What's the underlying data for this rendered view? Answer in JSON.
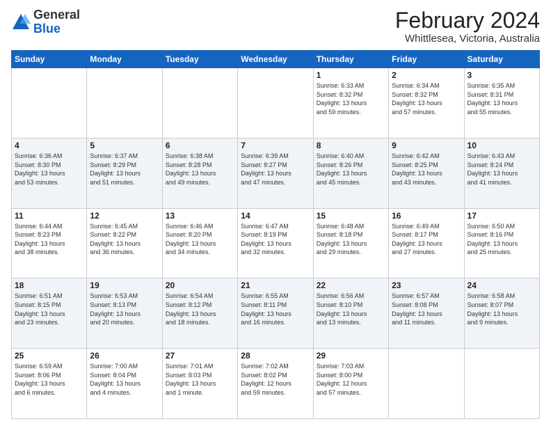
{
  "header": {
    "logo": {
      "line1": "General",
      "line2": "Blue"
    },
    "title": "February 2024",
    "location": "Whittlesea, Victoria, Australia"
  },
  "weekdays": [
    "Sunday",
    "Monday",
    "Tuesday",
    "Wednesday",
    "Thursday",
    "Friday",
    "Saturday"
  ],
  "weeks": [
    [
      {
        "day": "",
        "info": ""
      },
      {
        "day": "",
        "info": ""
      },
      {
        "day": "",
        "info": ""
      },
      {
        "day": "",
        "info": ""
      },
      {
        "day": "1",
        "info": "Sunrise: 6:33 AM\nSunset: 8:32 PM\nDaylight: 13 hours\nand 59 minutes."
      },
      {
        "day": "2",
        "info": "Sunrise: 6:34 AM\nSunset: 8:32 PM\nDaylight: 13 hours\nand 57 minutes."
      },
      {
        "day": "3",
        "info": "Sunrise: 6:35 AM\nSunset: 8:31 PM\nDaylight: 13 hours\nand 55 minutes."
      }
    ],
    [
      {
        "day": "4",
        "info": "Sunrise: 6:36 AM\nSunset: 8:30 PM\nDaylight: 13 hours\nand 53 minutes."
      },
      {
        "day": "5",
        "info": "Sunrise: 6:37 AM\nSunset: 8:29 PM\nDaylight: 13 hours\nand 51 minutes."
      },
      {
        "day": "6",
        "info": "Sunrise: 6:38 AM\nSunset: 8:28 PM\nDaylight: 13 hours\nand 49 minutes."
      },
      {
        "day": "7",
        "info": "Sunrise: 6:39 AM\nSunset: 8:27 PM\nDaylight: 13 hours\nand 47 minutes."
      },
      {
        "day": "8",
        "info": "Sunrise: 6:40 AM\nSunset: 8:26 PM\nDaylight: 13 hours\nand 45 minutes."
      },
      {
        "day": "9",
        "info": "Sunrise: 6:42 AM\nSunset: 8:25 PM\nDaylight: 13 hours\nand 43 minutes."
      },
      {
        "day": "10",
        "info": "Sunrise: 6:43 AM\nSunset: 8:24 PM\nDaylight: 13 hours\nand 41 minutes."
      }
    ],
    [
      {
        "day": "11",
        "info": "Sunrise: 6:44 AM\nSunset: 8:23 PM\nDaylight: 13 hours\nand 38 minutes."
      },
      {
        "day": "12",
        "info": "Sunrise: 6:45 AM\nSunset: 8:22 PM\nDaylight: 13 hours\nand 36 minutes."
      },
      {
        "day": "13",
        "info": "Sunrise: 6:46 AM\nSunset: 8:20 PM\nDaylight: 13 hours\nand 34 minutes."
      },
      {
        "day": "14",
        "info": "Sunrise: 6:47 AM\nSunset: 8:19 PM\nDaylight: 13 hours\nand 32 minutes."
      },
      {
        "day": "15",
        "info": "Sunrise: 6:48 AM\nSunset: 8:18 PM\nDaylight: 13 hours\nand 29 minutes."
      },
      {
        "day": "16",
        "info": "Sunrise: 6:49 AM\nSunset: 8:17 PM\nDaylight: 13 hours\nand 27 minutes."
      },
      {
        "day": "17",
        "info": "Sunrise: 6:50 AM\nSunset: 8:16 PM\nDaylight: 13 hours\nand 25 minutes."
      }
    ],
    [
      {
        "day": "18",
        "info": "Sunrise: 6:51 AM\nSunset: 8:15 PM\nDaylight: 13 hours\nand 23 minutes."
      },
      {
        "day": "19",
        "info": "Sunrise: 6:53 AM\nSunset: 8:13 PM\nDaylight: 13 hours\nand 20 minutes."
      },
      {
        "day": "20",
        "info": "Sunrise: 6:54 AM\nSunset: 8:12 PM\nDaylight: 13 hours\nand 18 minutes."
      },
      {
        "day": "21",
        "info": "Sunrise: 6:55 AM\nSunset: 8:11 PM\nDaylight: 13 hours\nand 16 minutes."
      },
      {
        "day": "22",
        "info": "Sunrise: 6:56 AM\nSunset: 8:10 PM\nDaylight: 13 hours\nand 13 minutes."
      },
      {
        "day": "23",
        "info": "Sunrise: 6:57 AM\nSunset: 8:08 PM\nDaylight: 13 hours\nand 11 minutes."
      },
      {
        "day": "24",
        "info": "Sunrise: 6:58 AM\nSunset: 8:07 PM\nDaylight: 13 hours\nand 9 minutes."
      }
    ],
    [
      {
        "day": "25",
        "info": "Sunrise: 6:59 AM\nSunset: 8:06 PM\nDaylight: 13 hours\nand 6 minutes."
      },
      {
        "day": "26",
        "info": "Sunrise: 7:00 AM\nSunset: 8:04 PM\nDaylight: 13 hours\nand 4 minutes."
      },
      {
        "day": "27",
        "info": "Sunrise: 7:01 AM\nSunset: 8:03 PM\nDaylight: 13 hours\nand 1 minute."
      },
      {
        "day": "28",
        "info": "Sunrise: 7:02 AM\nSunset: 8:02 PM\nDaylight: 12 hours\nand 59 minutes."
      },
      {
        "day": "29",
        "info": "Sunrise: 7:03 AM\nSunset: 8:00 PM\nDaylight: 12 hours\nand 57 minutes."
      },
      {
        "day": "",
        "info": ""
      },
      {
        "day": "",
        "info": ""
      }
    ]
  ]
}
